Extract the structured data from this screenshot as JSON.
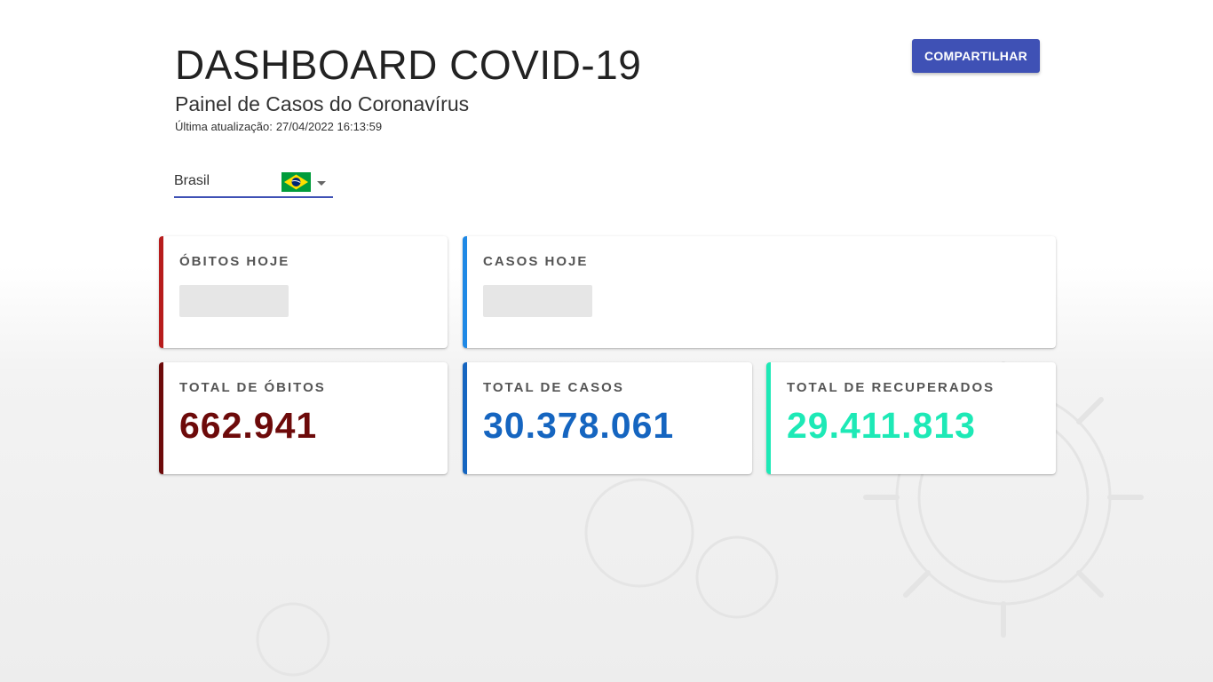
{
  "header": {
    "title": "DASHBOARD COVID-19",
    "subtitle": "Painel de Casos do Coronavírus",
    "updated_label": "Última atualização:",
    "updated_value": "27/04/2022 16:13:59"
  },
  "toolbar": {
    "share_label": "COMPARTILHAR"
  },
  "country_select": {
    "value": "Brasil",
    "flag_icon": "brazil-flag-icon"
  },
  "cards": {
    "deaths_today": {
      "label": "ÓBITOS HOJE",
      "color": "#b71c1c"
    },
    "cases_today": {
      "label": "CASOS HOJE",
      "color": "#1e88e5"
    },
    "total_deaths": {
      "label": "TOTAL DE ÓBITOS",
      "value": "662.941",
      "color": "#6d0a0a"
    },
    "total_cases": {
      "label": "TOTAL DE CASOS",
      "value": "30.378.061",
      "color": "#1565c0"
    },
    "total_recovered": {
      "label": "TOTAL DE RECUPERADOS",
      "value": "29.411.813",
      "color": "#1de9b6"
    }
  },
  "colors": {
    "primary": "#3f51b5"
  }
}
